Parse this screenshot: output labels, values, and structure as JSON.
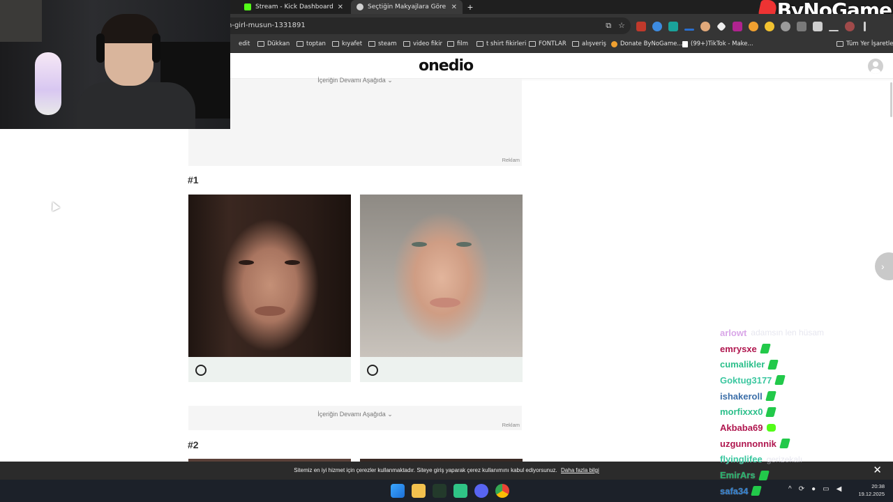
{
  "browser": {
    "tabs": [
      {
        "title": "Stream - Kick Dashboard",
        "close": "✕",
        "favicon_color": "#53fc18"
      },
      {
        "title": "Seçtiğin Makyajlara Göre Clean",
        "close": "✕",
        "favicon_color": "#d0d0d0"
      }
    ],
    "new_tab": "+",
    "url": "n-girl-musun-1331891",
    "bookmarks": [
      {
        "label": "edit",
        "folder": false
      },
      {
        "label": "Dükkan",
        "folder": true
      },
      {
        "label": "toptan",
        "folder": true
      },
      {
        "label": "kıyafet",
        "folder": true
      },
      {
        "label": "steam",
        "folder": true
      },
      {
        "label": "video fikir",
        "folder": true
      },
      {
        "label": "film",
        "folder": true
      },
      {
        "label": "t shirt fikirleri",
        "folder": true
      },
      {
        "label": "FONTLAR",
        "folder": true
      },
      {
        "label": "alışveriş",
        "folder": true
      },
      {
        "label": "Donate ByNoGame...",
        "folder": false
      },
      {
        "label": "(99+)TikTok - Make...",
        "folder": false
      }
    ],
    "all_bookmarks": "Tüm Yer İşaretleri"
  },
  "overlay": {
    "brand": "ByNoGame"
  },
  "site": {
    "logo": "onedio",
    "ad_continue": "İçeriğin Devamı Aşağıda ⌄",
    "ad_label": "Reklam",
    "sections": [
      {
        "title": "#1"
      },
      {
        "title": "#2"
      }
    ]
  },
  "cookie": {
    "text": "Sitemiz en iyi hizmet için çerezler kullanmaktadır. Siteye giriş yaparak çerez kullanımını kabul ediyorsunuz.",
    "link": "Daha fazla bilgi",
    "close": "✕"
  },
  "taskbar": {
    "time": "20:38",
    "date": "19.12.2025"
  },
  "chat": [
    {
      "user": "arlowt",
      "color": "#d9a7e8",
      "badge": "none",
      "text": "adamsın len hüsam"
    },
    {
      "user": "emrysxe",
      "color": "#b0174f",
      "badge": "leaf",
      "text": ""
    },
    {
      "user": "cumalikler",
      "color": "#2bbf8a",
      "badge": "leaf",
      "text": ""
    },
    {
      "user": "Goktug3177",
      "color": "#3cc7a0",
      "badge": "leaf",
      "text": ""
    },
    {
      "user": "ishakeroll",
      "color": "#3b6ea8",
      "badge": "leaf",
      "text": ""
    },
    {
      "user": "morfixxx0",
      "color": "#2bbf8a",
      "badge": "leaf",
      "text": ""
    },
    {
      "user": "Akbaba69",
      "color": "#b0174f",
      "badge": "round",
      "text": ""
    },
    {
      "user": "uzgunnonnik",
      "color": "#b0174f",
      "badge": "leaf",
      "text": ""
    },
    {
      "user": "flyinglifee",
      "color": "#3cc7a0",
      "badge": "none",
      "text": "gerizekalı"
    },
    {
      "user": "EmirArs",
      "color": "#25b26a",
      "badge": "leaf",
      "text": ""
    },
    {
      "user": "safa34",
      "color": "#2f7fd0",
      "badge": "leaf",
      "text": ""
    }
  ]
}
